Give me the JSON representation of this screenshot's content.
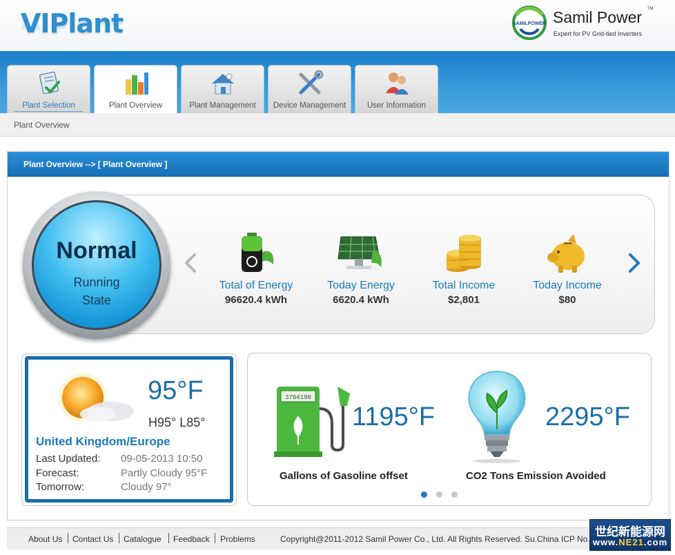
{
  "header": {
    "logo": "VIPlant",
    "brand_name": "Samil Power",
    "brand_tm": "TM",
    "brand_tagline": "Expert for PV Grid-tied Inverters",
    "brand_mark_text": "SAMILPOWER"
  },
  "tabs": [
    {
      "label": "Plant Selection",
      "icon": "document-check-icon"
    },
    {
      "label": "Plant Overview",
      "icon": "bar-chart-icon",
      "active": true
    },
    {
      "label": "Plant Management",
      "icon": "house-icon"
    },
    {
      "label": "Device Management",
      "icon": "tools-icon"
    },
    {
      "label": "User Information",
      "icon": "users-icon"
    }
  ],
  "breadcrumb": "Plant Overview",
  "panel": {
    "title": "Plant Overview --> [ Plant Overview ]"
  },
  "status": {
    "main": "Normal",
    "line1": "Running",
    "line2": "State"
  },
  "stats": [
    {
      "label": "Total of Energy",
      "value": "96620.4 kWh",
      "icon": "battery-icon"
    },
    {
      "label": "Today Energy",
      "value": "6620.4 kWh",
      "icon": "solar-panel-icon"
    },
    {
      "label": "Total Income",
      "value": "$2,801",
      "icon": "coins-icon"
    },
    {
      "label": "Today Income",
      "value": "$80",
      "icon": "piggy-bank-icon"
    }
  ],
  "weather": {
    "temperature": "95°F",
    "hilo": "H95° L85°",
    "location": "United Kingdom/Europe",
    "rows": [
      {
        "key": "Last Updated:",
        "value": "09-05-2013 10:50"
      },
      {
        "key": "Forecast:",
        "value": "Partly Cloudy 95°F"
      },
      {
        "key": "Tomorrow:",
        "value": "Cloudy 97°"
      }
    ]
  },
  "environment": {
    "gasoline_value": "1195°F",
    "gasoline_label": "Gallons of Gasoline offset",
    "pump_counter": "3704190",
    "co2_value": "2295°F",
    "co2_label": "CO2 Tons Emission Avoided",
    "pager_active": 1,
    "pager_count": 3
  },
  "footer": {
    "links": [
      "About Us",
      "Contact Us",
      "Catalogue",
      "Feedback",
      "Problems"
    ],
    "copyright": "Copyright@2011-2012 Samil Power Co., Ltd. All Rights Reserved. Su.China ICP No."
  },
  "watermark": {
    "chinese": "世纪新能源网",
    "url_prefix": "www.",
    "url_highlight": "NE21",
    "url_suffix": ".com"
  },
  "colors": {
    "accent_blue": "#1a7abf",
    "tab_band": "#3a9bdc",
    "weather_border": "#1a6ea8",
    "badge_blue": "#43bff0"
  }
}
